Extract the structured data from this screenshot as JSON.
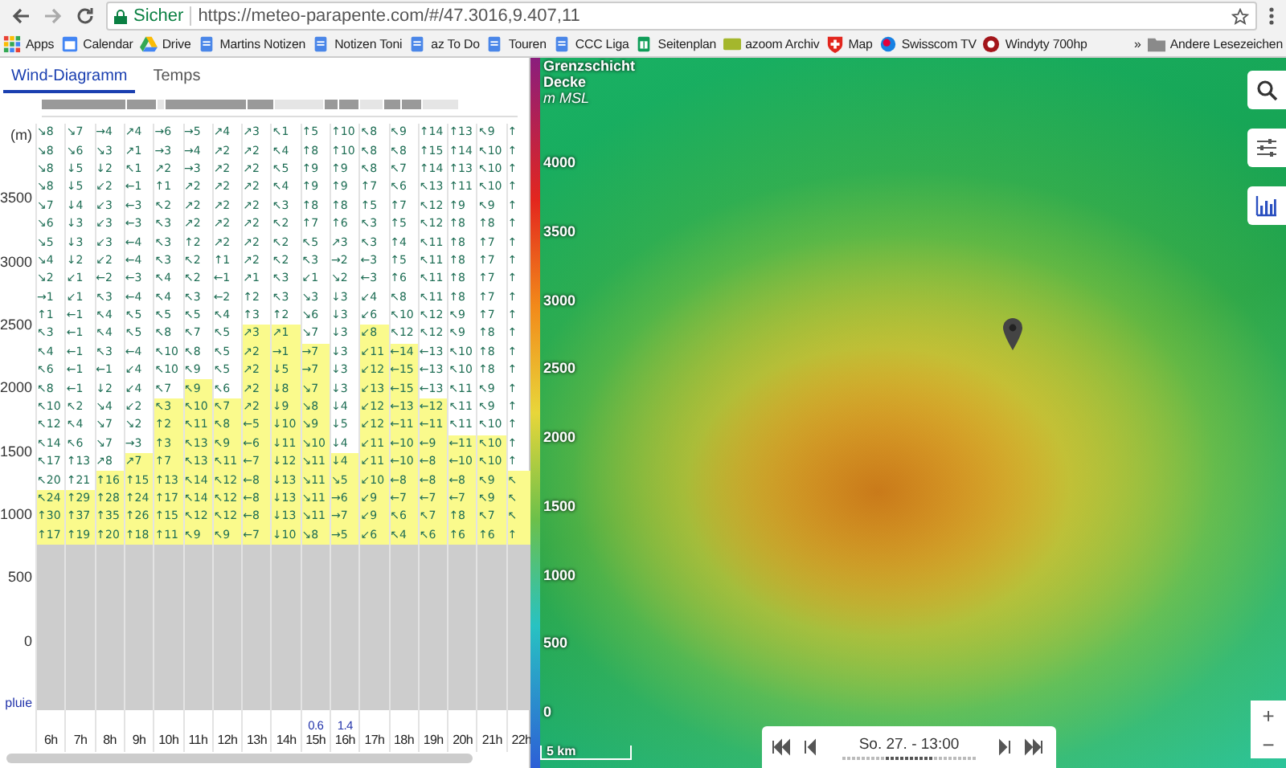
{
  "browser": {
    "secure_label": "Sicher",
    "url": "https://meteo-parapente.com/#/47.3016,9.407,11",
    "bookmarks": [
      {
        "label": "Apps",
        "kind": "apps"
      },
      {
        "label": "Calendar",
        "kind": "calendar"
      },
      {
        "label": "Drive",
        "kind": "drive"
      },
      {
        "label": "Martins Notizen",
        "kind": "doc"
      },
      {
        "label": "Notizen Toni",
        "kind": "doc"
      },
      {
        "label": "az To Do",
        "kind": "doc"
      },
      {
        "label": "Touren",
        "kind": "doc"
      },
      {
        "label": "CCC Liga",
        "kind": "doc"
      },
      {
        "label": "Seitenplan",
        "kind": "sheet"
      },
      {
        "label": "azoom Archiv",
        "kind": "azoom"
      },
      {
        "label": "Map",
        "kind": "shield"
      },
      {
        "label": "Swisscom TV",
        "kind": "swisscom"
      },
      {
        "label": "Windyty 700hp",
        "kind": "windy"
      }
    ],
    "overflow": "»",
    "other_bookmarks": "Andere Lesezeichen"
  },
  "tabs": [
    {
      "label": "Wind-Diagramm",
      "selected": true
    },
    {
      "label": "Temps",
      "selected": false
    }
  ],
  "diagram": {
    "y_labels": [
      "(m)",
      "3500",
      "3000",
      "2500",
      "2000",
      "1500",
      "1000",
      "500",
      "0"
    ],
    "rain_label": "pluie",
    "columns": [
      {
        "time": "6h",
        "upper": [
          "↘8",
          "↘8",
          "↘8",
          "↘8",
          "↘7",
          "↘6",
          "↘5",
          "↘4",
          "↘2",
          "→1",
          "↑1",
          "↖3",
          "↖4",
          "↖6",
          "↖8",
          "↖10",
          "↖12",
          "↖14",
          "↖17",
          "↖20"
        ],
        "thermal": [
          "↖24",
          "↑30",
          "↑17"
        ]
      },
      {
        "time": "7h",
        "upper": [
          "↘7",
          "↘6",
          "↓5",
          "↓5",
          "↓4",
          "↓3",
          "↓3",
          "↓2",
          "↙1",
          "↙1",
          "←1",
          "←1",
          "←1",
          "←1",
          "←1",
          "↖2",
          "↖4",
          "↖6",
          "↑13",
          "↑21"
        ],
        "thermal": [
          "↑29",
          "↑37",
          "↑19"
        ]
      },
      {
        "time": "8h",
        "upper": [
          "→4",
          "↘3",
          "↓2",
          "↙2",
          "↙3",
          "↙3",
          "↙3",
          "↙2",
          "←2",
          "↖3",
          "↖4",
          "↖4",
          "↖3",
          "←1",
          "↓2",
          "↘4",
          "↘7",
          "↘7",
          "↗8"
        ],
        "thermal": [
          "↑16",
          "↑28",
          "↑35",
          "↑20"
        ]
      },
      {
        "time": "9h",
        "upper": [
          "↗4",
          "↗1",
          "↖1",
          "←1",
          "←3",
          "←3",
          "←4",
          "←4",
          "←3",
          "←4",
          "↖5",
          "↖5",
          "←4",
          "↙4",
          "↙4",
          "↙2",
          "↘2",
          "→3"
        ],
        "thermal": [
          "↗7",
          "↑15",
          "↑24",
          "↑26",
          "↑18"
        ]
      },
      {
        "time": "10h",
        "upper": [
          "→6",
          "→3",
          "↗2",
          "↑1",
          "↖2",
          "↖3",
          "↖3",
          "↖3",
          "↖4",
          "↖4",
          "↖5",
          "↖8",
          "↖10",
          "↖10",
          "↖7"
        ],
        "thermal": [
          "↖3",
          "↑2",
          "↑3",
          "↑7",
          "↑13",
          "↑17",
          "↑15",
          "↑11"
        ]
      },
      {
        "time": "11h",
        "upper": [
          "→5",
          "→4",
          "→3",
          "↗2",
          "↗2",
          "↗2",
          "↑2",
          "↖2",
          "↖2",
          "↖3",
          "↖5",
          "↖7",
          "↖8",
          "↖9"
        ],
        "thermal": [
          "↖9",
          "↖10",
          "↖11",
          "↖13",
          "↖13",
          "↖14",
          "↖14",
          "↖12",
          "↖9"
        ]
      },
      {
        "time": "12h",
        "upper": [
          "↗4",
          "↗2",
          "↗2",
          "↗2",
          "↗2",
          "↗2",
          "↗2",
          "↑1",
          "←1",
          "←2",
          "↖4",
          "↖5",
          "↖5",
          "↖5",
          "↖6"
        ],
        "thermal": [
          "↖7",
          "↖8",
          "↖9",
          "↖11",
          "↖12",
          "↖12",
          "↖12",
          "↖9"
        ]
      },
      {
        "time": "13h",
        "upper": [
          "↗3",
          "↗2",
          "↗2",
          "↗2",
          "↗2",
          "↗2",
          "↗2",
          "↗2",
          "↗1",
          "↑2",
          "↑3"
        ],
        "thermal": [
          "↗3",
          "↗2",
          "↗2",
          "↗2",
          "↗2",
          "←5",
          "←6",
          "←7",
          "←8",
          "←8",
          "←8",
          "←7"
        ]
      },
      {
        "time": "14h",
        "upper": [
          "↖1",
          "↖4",
          "↖5",
          "↖4",
          "↖3",
          "↖2",
          "↖2",
          "↖2",
          "↖3",
          "↖3",
          "↑2"
        ],
        "thermal": [
          "↗1",
          "→1",
          "↓5",
          "↓8",
          "↓9",
          "↓10",
          "↓11",
          "↓12",
          "↓13",
          "↓13",
          "↓13",
          "↓10"
        ]
      },
      {
        "time": "15h",
        "rain": "0.6",
        "upper": [
          "↑5",
          "↑8",
          "↑9",
          "↑9",
          "↑8",
          "↑7",
          "↖5",
          "↖3",
          "↙1",
          "↘3",
          "↘6",
          "↘7"
        ],
        "thermal": [
          "→7",
          "→7",
          "↘7",
          "↘8",
          "↘9",
          "↘10",
          "↘11",
          "↘11",
          "↘11",
          "↘11",
          "↘8"
        ]
      },
      {
        "time": "16h",
        "rain": "1.4",
        "upper": [
          "↑10",
          "↑10",
          "↑9",
          "↑9",
          "↑8",
          "↑6",
          "↗3",
          "→2",
          "↘2",
          "↓3",
          "↓3",
          "↓3",
          "↓3",
          "↓3",
          "↓3",
          "↓4",
          "↓5",
          "↓4"
        ],
        "thermal": [
          "↓4",
          "↘5",
          "→6",
          "→7",
          "→5"
        ]
      },
      {
        "time": "17h",
        "upper": [
          "↖8",
          "↖8",
          "↖8",
          "↑7",
          "↑5",
          "↖3",
          "↖3",
          "←3",
          "←3",
          "↙4",
          "↙6"
        ],
        "thermal": [
          "↙8",
          "↙11",
          "↙12",
          "↙13",
          "↙12",
          "↙12",
          "↙11",
          "↙11",
          "↙10",
          "↙9",
          "↙9",
          "↙6"
        ]
      },
      {
        "time": "18h",
        "upper": [
          "↖9",
          "↖8",
          "↖7",
          "↖6",
          "↑7",
          "↑5",
          "↑4",
          "↑5",
          "↑6",
          "↖8",
          "↖10",
          "↖12"
        ],
        "thermal": [
          "←14",
          "←15",
          "←15",
          "←13",
          "←11",
          "←10",
          "←10",
          "←8",
          "←7",
          "↖6",
          "↖4"
        ]
      },
      {
        "time": "19h",
        "upper": [
          "↑14",
          "↑15",
          "↑14",
          "↖13",
          "↖12",
          "↖12",
          "↖11",
          "↖11",
          "↖11",
          "↖11",
          "↖12",
          "↖12",
          "←13",
          "←13",
          "←13"
        ],
        "thermal": [
          "←12",
          "←11",
          "←9",
          "←8",
          "←8",
          "←7",
          "↖7",
          "↖6"
        ]
      },
      {
        "time": "20h",
        "upper": [
          "↑13",
          "↑14",
          "↑13",
          "↑11",
          "↑9",
          "↑8",
          "↑8",
          "↑8",
          "↑8",
          "↑8",
          "↖9",
          "↖9",
          "↖10",
          "↖10",
          "↖11",
          "↖11",
          "↖11"
        ],
        "thermal": [
          "←11",
          "←10",
          "←8",
          "←7",
          "↑8",
          "↑6"
        ]
      },
      {
        "time": "21h",
        "upper": [
          "↖9",
          "↖10",
          "↖10",
          "↖10",
          "↖9",
          "↑8",
          "↑7",
          "↑7",
          "↑7",
          "↑7",
          "↑7",
          "↑8",
          "↑8",
          "↑8",
          "↖9",
          "↖9",
          "↖10"
        ],
        "thermal": [
          "↖10",
          "↖10",
          "↖9",
          "↖9",
          "↖7",
          "↑6"
        ]
      },
      {
        "time": "22h",
        "upper": [
          "↑",
          "↑",
          "↑",
          "↑",
          "↑",
          "↑",
          "↑",
          "↑",
          "↑",
          "↑",
          "↑",
          "↑",
          "↑",
          "↑",
          "↑",
          "↑",
          "↑",
          "↑",
          "↑"
        ],
        "thermal": [
          "↖",
          "↖",
          "↖",
          "↑"
        ]
      }
    ]
  },
  "map": {
    "legend_title": "Grenzschicht",
    "legend_subtitle": "Decke",
    "legend_unit": "m MSL",
    "legend_scale": [
      "4000",
      "3500",
      "3000",
      "2500",
      "2000",
      "1500",
      "1000",
      "500",
      "0"
    ],
    "time": "So. 27. - 13:00",
    "slider": {
      "level": 0.5
    },
    "scale_bar": "5 km",
    "zoom": [
      "+",
      "−"
    ]
  }
}
